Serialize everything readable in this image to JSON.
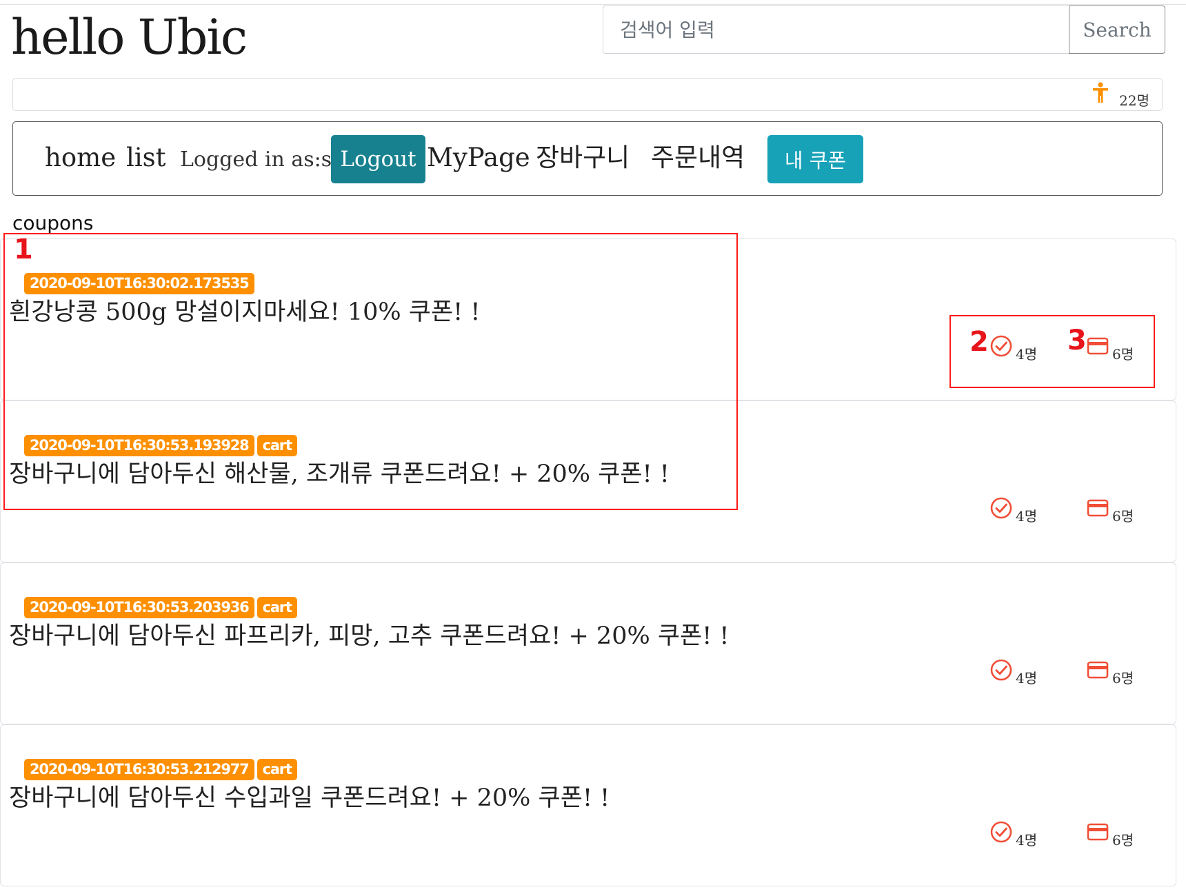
{
  "header": {
    "site_title": "hello Ubic",
    "search_placeholder": "검색어 입력",
    "search_button": "Search"
  },
  "visitor": {
    "icon": "accessibility-person-icon",
    "count": "22명",
    "icon_color": "#fd8f00"
  },
  "nav": {
    "home": "home",
    "list": "list",
    "logged_in": "Logged in as:sisi",
    "logout": "Logout",
    "mypage": "MyPage",
    "cart": "장바구니",
    "orders": "주문내역",
    "my_coupons": "내 쿠폰"
  },
  "section_label": "coupons",
  "coupons": [
    {
      "date": "2020-09-10T16:30:02.173535",
      "tag": "",
      "title": "흰강낭콩 500g 망설이지마세요!  10% 쿠폰! !",
      "used_count": "4명",
      "cart_count": "6명"
    },
    {
      "date": "2020-09-10T16:30:53.193928",
      "tag": "cart",
      "title": "장바구니에 담아두신 해산물, 조개류 쿠폰드려요!  + 20% 쿠폰! !",
      "used_count": "4명",
      "cart_count": "6명"
    },
    {
      "date": "2020-09-10T16:30:53.203936",
      "tag": "cart",
      "title": "장바구니에 담아두신 파프리카, 피망, 고추 쿠폰드려요!  + 20% 쿠폰! !",
      "used_count": "4명",
      "cart_count": "6명"
    },
    {
      "date": "2020-09-10T16:30:53.212977",
      "tag": "cart",
      "title": "장바구니에 담아두신 수입과일 쿠폰드려요!  + 20% 쿠폰! !",
      "used_count": "4명",
      "cart_count": "6명"
    }
  ],
  "annotations": {
    "one": "1",
    "two": "2",
    "three": "3",
    "color": "#ff1a1a"
  },
  "colors": {
    "badge": "#fd8f00",
    "logout": "#17818f",
    "coupon_button": "#17a2b8",
    "stat_icon": "#f04e37"
  }
}
